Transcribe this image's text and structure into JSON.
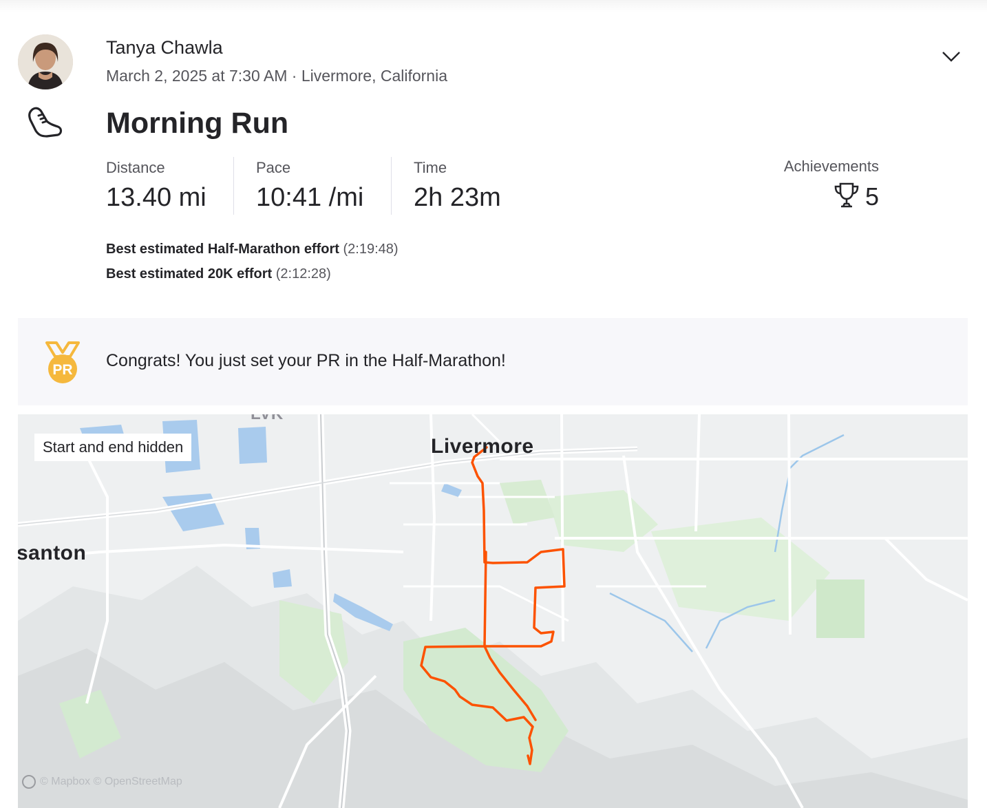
{
  "athlete": {
    "name": "Tanya Chawla",
    "datetime": "March 2, 2025 at 7:30 AM",
    "location": "Livermore, California",
    "meta_line": "March 2, 2025 at 7:30 AM · Livermore, California"
  },
  "activity": {
    "sport_icon": "running-shoe-icon",
    "title": "Morning Run",
    "stats": [
      {
        "label": "Distance",
        "value": "13.40 mi"
      },
      {
        "label": "Pace",
        "value": "10:41 /mi"
      },
      {
        "label": "Time",
        "value": "2h 23m"
      }
    ],
    "achievements": {
      "label": "Achievements",
      "icon": "trophy-icon",
      "count": "5"
    },
    "best_efforts": [
      {
        "label": "Best estimated Half-Marathon effort",
        "time": "(2:19:48)"
      },
      {
        "label": "Best estimated 20K effort",
        "time": "(2:12:28)"
      }
    ]
  },
  "pr_banner": {
    "icon": "pr-medal-icon",
    "medal_text": "PR",
    "message": "Congrats! You just set your PR in the Half-Marathon!"
  },
  "map": {
    "privacy_chip": "Start and end hidden",
    "labels": {
      "city": "Livermore",
      "west_city": "santon",
      "airport": "LVK"
    },
    "attribution": "© Mapbox © OpenStreetMap",
    "route_color": "#fc5200"
  },
  "colors": {
    "brand_orange": "#fc5200",
    "medal_gold": "#f5b83d",
    "text_primary": "#242428",
    "text_secondary": "#55555b"
  }
}
